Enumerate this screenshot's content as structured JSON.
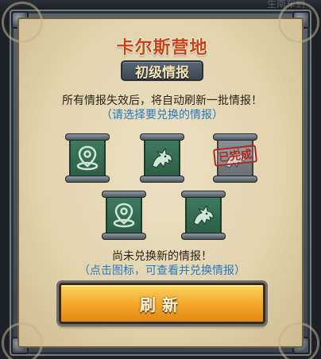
{
  "background": {
    "top_text": "生南车到"
  },
  "panel": {
    "title": "卡尔斯营地",
    "subtitle": "初级情报",
    "info_line": "所有情报失效后，将自动刷新一批情报！",
    "select_hint": "（请选择要兑换的情报）",
    "not_exchanged": "尚未兑换新的情报！",
    "click_hint": "（点击图标，可查看并兑换情报）",
    "refresh_label": "刷新"
  },
  "scrolls": [
    {
      "icon": "map-pin-icon",
      "status": "available"
    },
    {
      "icon": "dragon-icon",
      "status": "available"
    },
    {
      "icon": "dragon-icon",
      "status": "used",
      "stamp": "已完成"
    },
    {
      "icon": "map-pin-icon",
      "status": "available"
    },
    {
      "icon": "dragon-icon",
      "status": "available"
    }
  ],
  "colors": {
    "title": "#c5421b",
    "hint": "#2b78c2",
    "button": "#f2a628",
    "stamp": "#b0281c"
  }
}
